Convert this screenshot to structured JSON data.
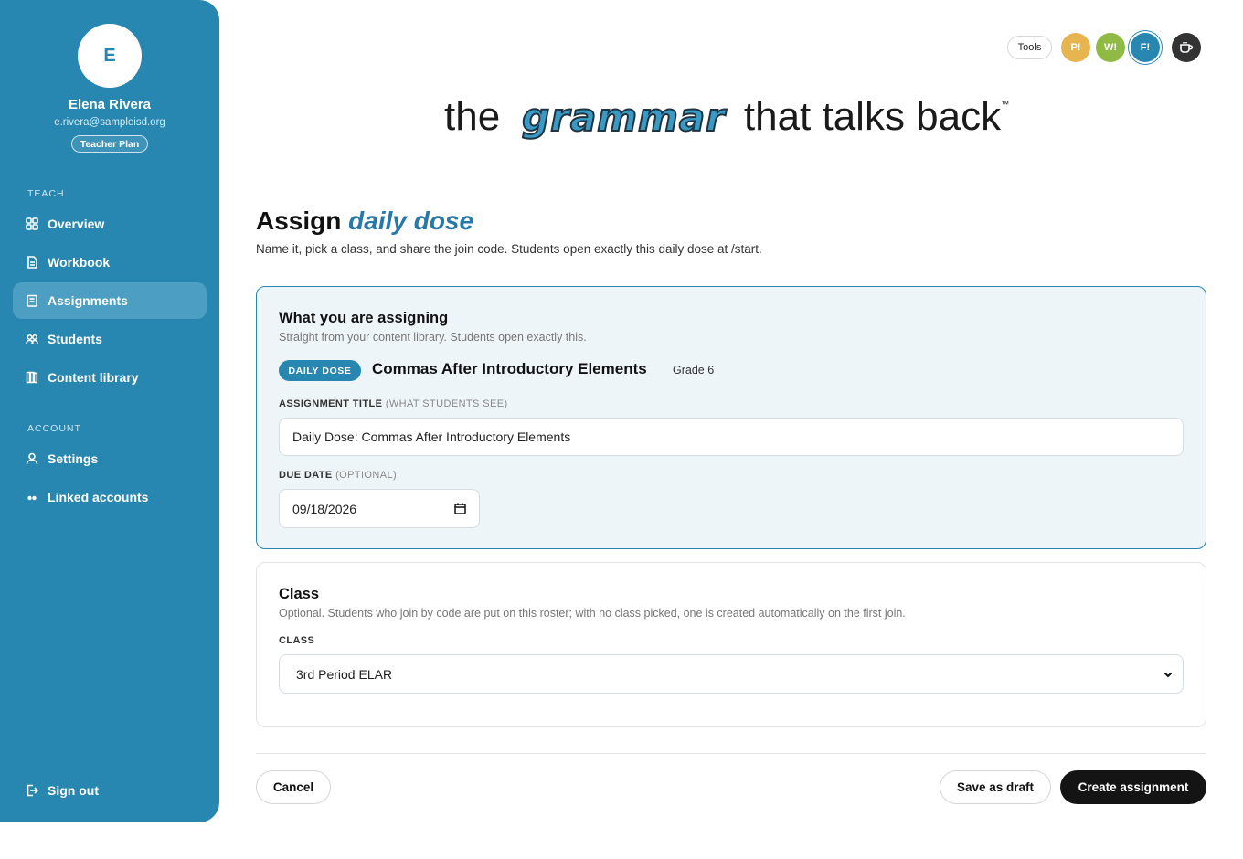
{
  "sidebar": {
    "avatar_initial": "E",
    "user_name": "Elena Rivera",
    "user_email": "e.rivera@sampleisd.org",
    "plan": "Teacher Plan",
    "teach_label": "TEACH",
    "account_label": "ACCOUNT",
    "items": [
      {
        "label": "Overview",
        "icon": "grid-icon"
      },
      {
        "label": "Workbook",
        "icon": "document-icon"
      },
      {
        "label": "Assignments",
        "icon": "clipboard-icon",
        "active": true
      },
      {
        "label": "Students",
        "icon": "people-icon"
      },
      {
        "label": "Content library",
        "icon": "books-icon"
      }
    ],
    "account_items": [
      {
        "label": "Settings",
        "icon": "user-icon"
      },
      {
        "label": "Linked accounts",
        "icon": "link-icon"
      }
    ],
    "sign_out": "Sign out"
  },
  "topbar": {
    "tools_label": "Tools",
    "p_label": "P!",
    "w_label": "W!",
    "f_label": "F!"
  },
  "logo": {
    "the": "the",
    "grammar": "grammar",
    "tagline": "that talks back",
    "tm": "™"
  },
  "page": {
    "title_prefix": "Assign",
    "title_accent": "daily dose",
    "subtitle": "Name it, pick a class, and share the join code. Students open exactly this daily dose at /start."
  },
  "assigning_card": {
    "title": "What you are assigning",
    "subtitle": "Straight from your content library. Students open exactly this.",
    "badge": "DAILY DOSE",
    "content_name": "Commas After Introductory Elements",
    "grade": "Grade 6",
    "title_field_label": "ASSIGNMENT TITLE",
    "title_field_hint": "(WHAT STUDENTS SEE)",
    "title_value": "Daily Dose: Commas After Introductory Elements",
    "due_label": "DUE DATE",
    "due_hint": "(OPTIONAL)",
    "due_value": "09/18/2026"
  },
  "class_card": {
    "title": "Class",
    "subtitle": "Optional. Students who join by code are put on this roster; with no class picked, one is created automatically on the first join.",
    "field_label": "CLASS",
    "selected": "3rd Period ELAR"
  },
  "actions": {
    "cancel": "Cancel",
    "draft": "Save as draft",
    "create": "Create assignment"
  },
  "colors": {
    "sidebar": "#2787b0",
    "accent": "#2679a8",
    "primary_button": "#141414"
  }
}
